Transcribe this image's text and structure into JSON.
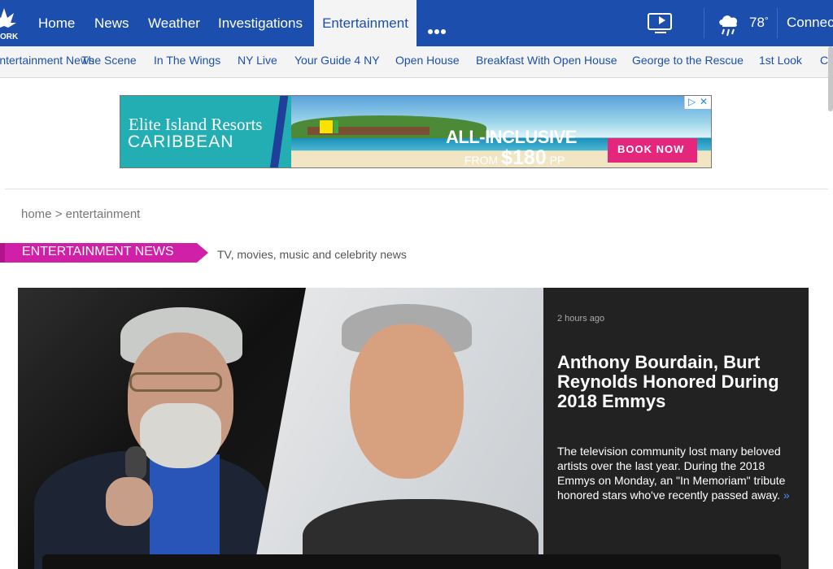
{
  "nav": {
    "logo_text": "ORK",
    "items": [
      {
        "label": "Home"
      },
      {
        "label": "News"
      },
      {
        "label": "Weather"
      },
      {
        "label": "Investigations"
      },
      {
        "label": "Entertainment"
      }
    ],
    "more_icon": "more-dots-icon",
    "video_icon": "video-player-icon",
    "weather_icon": "rain-cloud-icon",
    "temperature": "78",
    "temperature_unit": "°",
    "connect_label": "Connect"
  },
  "subnav": {
    "items": [
      {
        "label": "Entertainment News"
      },
      {
        "label": "The Scene"
      },
      {
        "label": "In The Wings"
      },
      {
        "label": "NY Live"
      },
      {
        "label": "Your Guide 4 NY"
      },
      {
        "label": "Open House"
      },
      {
        "label": "Breakfast With Open House"
      },
      {
        "label": "George to the Rescue"
      },
      {
        "label": "1st Look"
      },
      {
        "label": "CO"
      }
    ]
  },
  "ad": {
    "brand_line1": "Elite Island Resorts",
    "brand_line2": "CARIBBEAN",
    "headline": "ALL-INCLUSIVE",
    "price_prefix": "FROM",
    "price": "$180",
    "price_suffix": "PP",
    "cta": "BOOK NOW",
    "adchoices_icon": "adchoices-icon",
    "close_icon": "close-icon"
  },
  "breadcrumb": {
    "text": "home > entertainment"
  },
  "section": {
    "title": "ENTERTAINMENT NEWS",
    "subtitle": "TV, movies, music and celebrity news"
  },
  "hero": {
    "time": "2 hours ago",
    "title": "Anthony Bourdain, Burt Reynolds Honored During 2018 Emmys",
    "description": "The television community lost many beloved artists over the last year. During the 2018 Emmys on Monday, an \"In Memoriam\" tribute honored stars who've recently passed away.",
    "more_icon": "double-chevron-right-icon",
    "more_symbol": "»"
  },
  "colors": {
    "nav_blue": "#1c4fad",
    "accent_magenta": "#d020a7",
    "link_blue": "#1c4fad"
  }
}
